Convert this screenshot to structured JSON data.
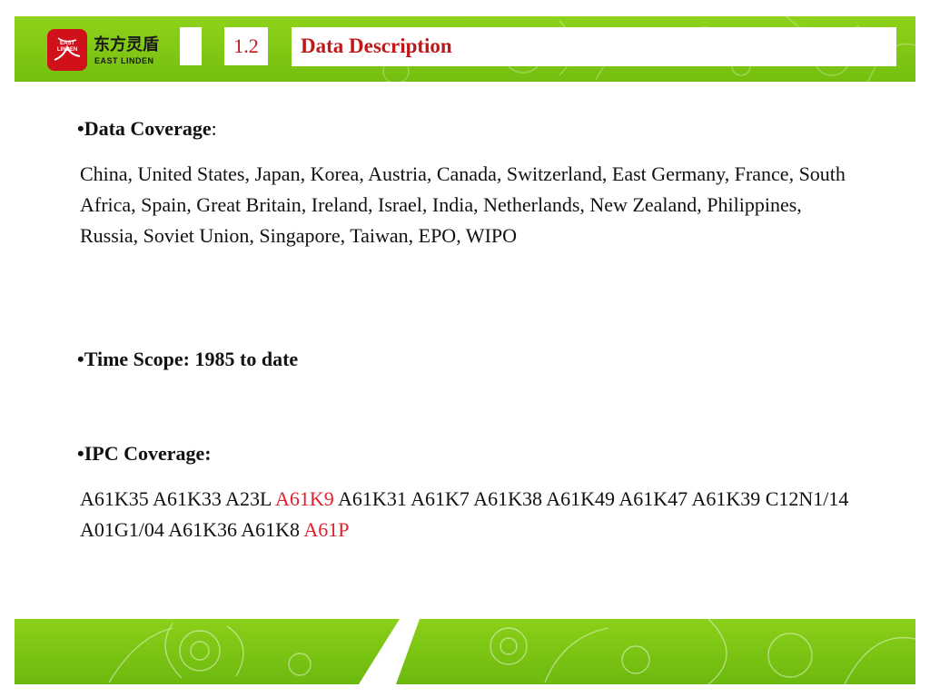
{
  "logo": {
    "seal_text": "EAST LINDEN",
    "name_cn": "东方灵盾",
    "name_en": "EAST LINDEN"
  },
  "header": {
    "section_number": "1.2",
    "title": "Data Description"
  },
  "sections": {
    "data_coverage": {
      "bullet": "•",
      "label": "Data Coverage",
      "colon": ":",
      "text": "China, United States, Japan, Korea, Austria, Canada, Switzerland, East Germany, France, South Africa, Spain, Great Britain, Ireland, Israel, India, Netherlands, New Zealand, Philippines, Russia, Soviet Union, Singapore, Taiwan, EPO, WIPO"
    },
    "time_scope": {
      "bullet": "•",
      "label": "Time Scope: 1985 to date"
    },
    "ipc_coverage": {
      "bullet": "•",
      "label": "IPC Coverage:",
      "codes": [
        {
          "code": "A61K35",
          "highlight": false
        },
        {
          "code": "A61K33",
          "highlight": false
        },
        {
          "code": "A23L",
          "highlight": false
        },
        {
          "code": "A61K9",
          "highlight": true
        },
        {
          "code": "A61K31",
          "highlight": false
        },
        {
          "code": "A61K7",
          "highlight": false
        },
        {
          "code": "A61K38",
          "highlight": false
        },
        {
          "code": "A61K49",
          "highlight": false
        },
        {
          "code": "A61K47",
          "highlight": false
        },
        {
          "code": "A61K39",
          "highlight": false
        },
        {
          "code": "C12N1/14",
          "highlight": false
        },
        {
          "code": "A01G1/04",
          "highlight": false
        },
        {
          "code": "A61K36",
          "highlight": false
        },
        {
          "code": "A61K8",
          "highlight": false
        },
        {
          "code": "A61P",
          "highlight": true
        }
      ]
    }
  },
  "colors": {
    "band_green": "#7cc514",
    "title_red": "#c01818",
    "highlight_red": "#e0202a"
  }
}
